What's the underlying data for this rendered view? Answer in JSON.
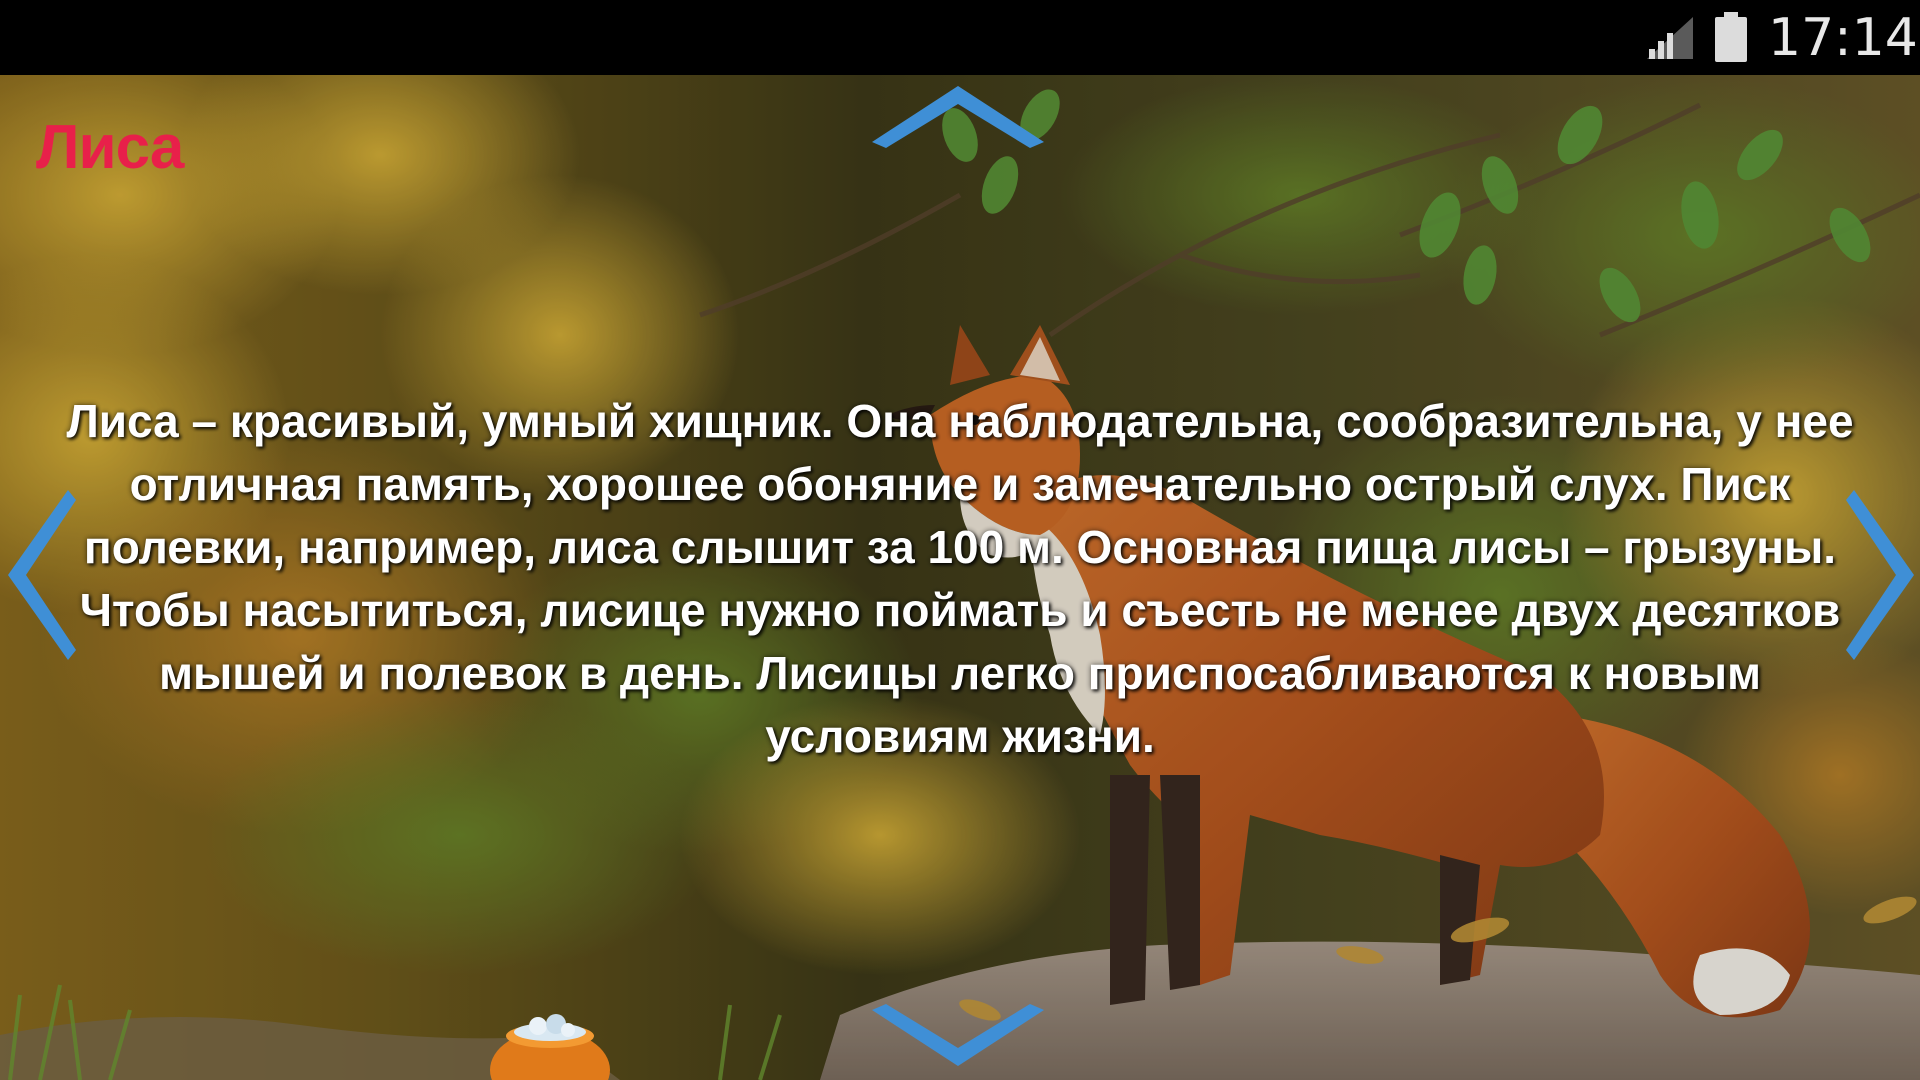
{
  "status_bar": {
    "time": "17:14",
    "icons": [
      "signal-icon",
      "battery-icon"
    ]
  },
  "screen": {
    "title": "Лиса",
    "title_color": "#e8204a",
    "description": "Лиса – красивый, умный хищник. Она наблюдательна, сообразительна, у нее отличная память, хорошее обоняние и замечательно острый слух. Писк полевки, например, лиса слышит за 100 м. Основная пища лисы – грызуны. Чтобы насытиться, лисице нужно поймать и съесть не менее двух десятков мышей и полевок в день. Лисицы легко приспосабливаются к новым условиям жизни."
  },
  "navigation": {
    "arrow_color": "#3f8fd6",
    "icons": [
      "chevron-up-icon",
      "chevron-down-icon",
      "chevron-left-icon",
      "chevron-right-icon"
    ]
  },
  "decor": {
    "pot_icon": "honey-pot-icon"
  }
}
